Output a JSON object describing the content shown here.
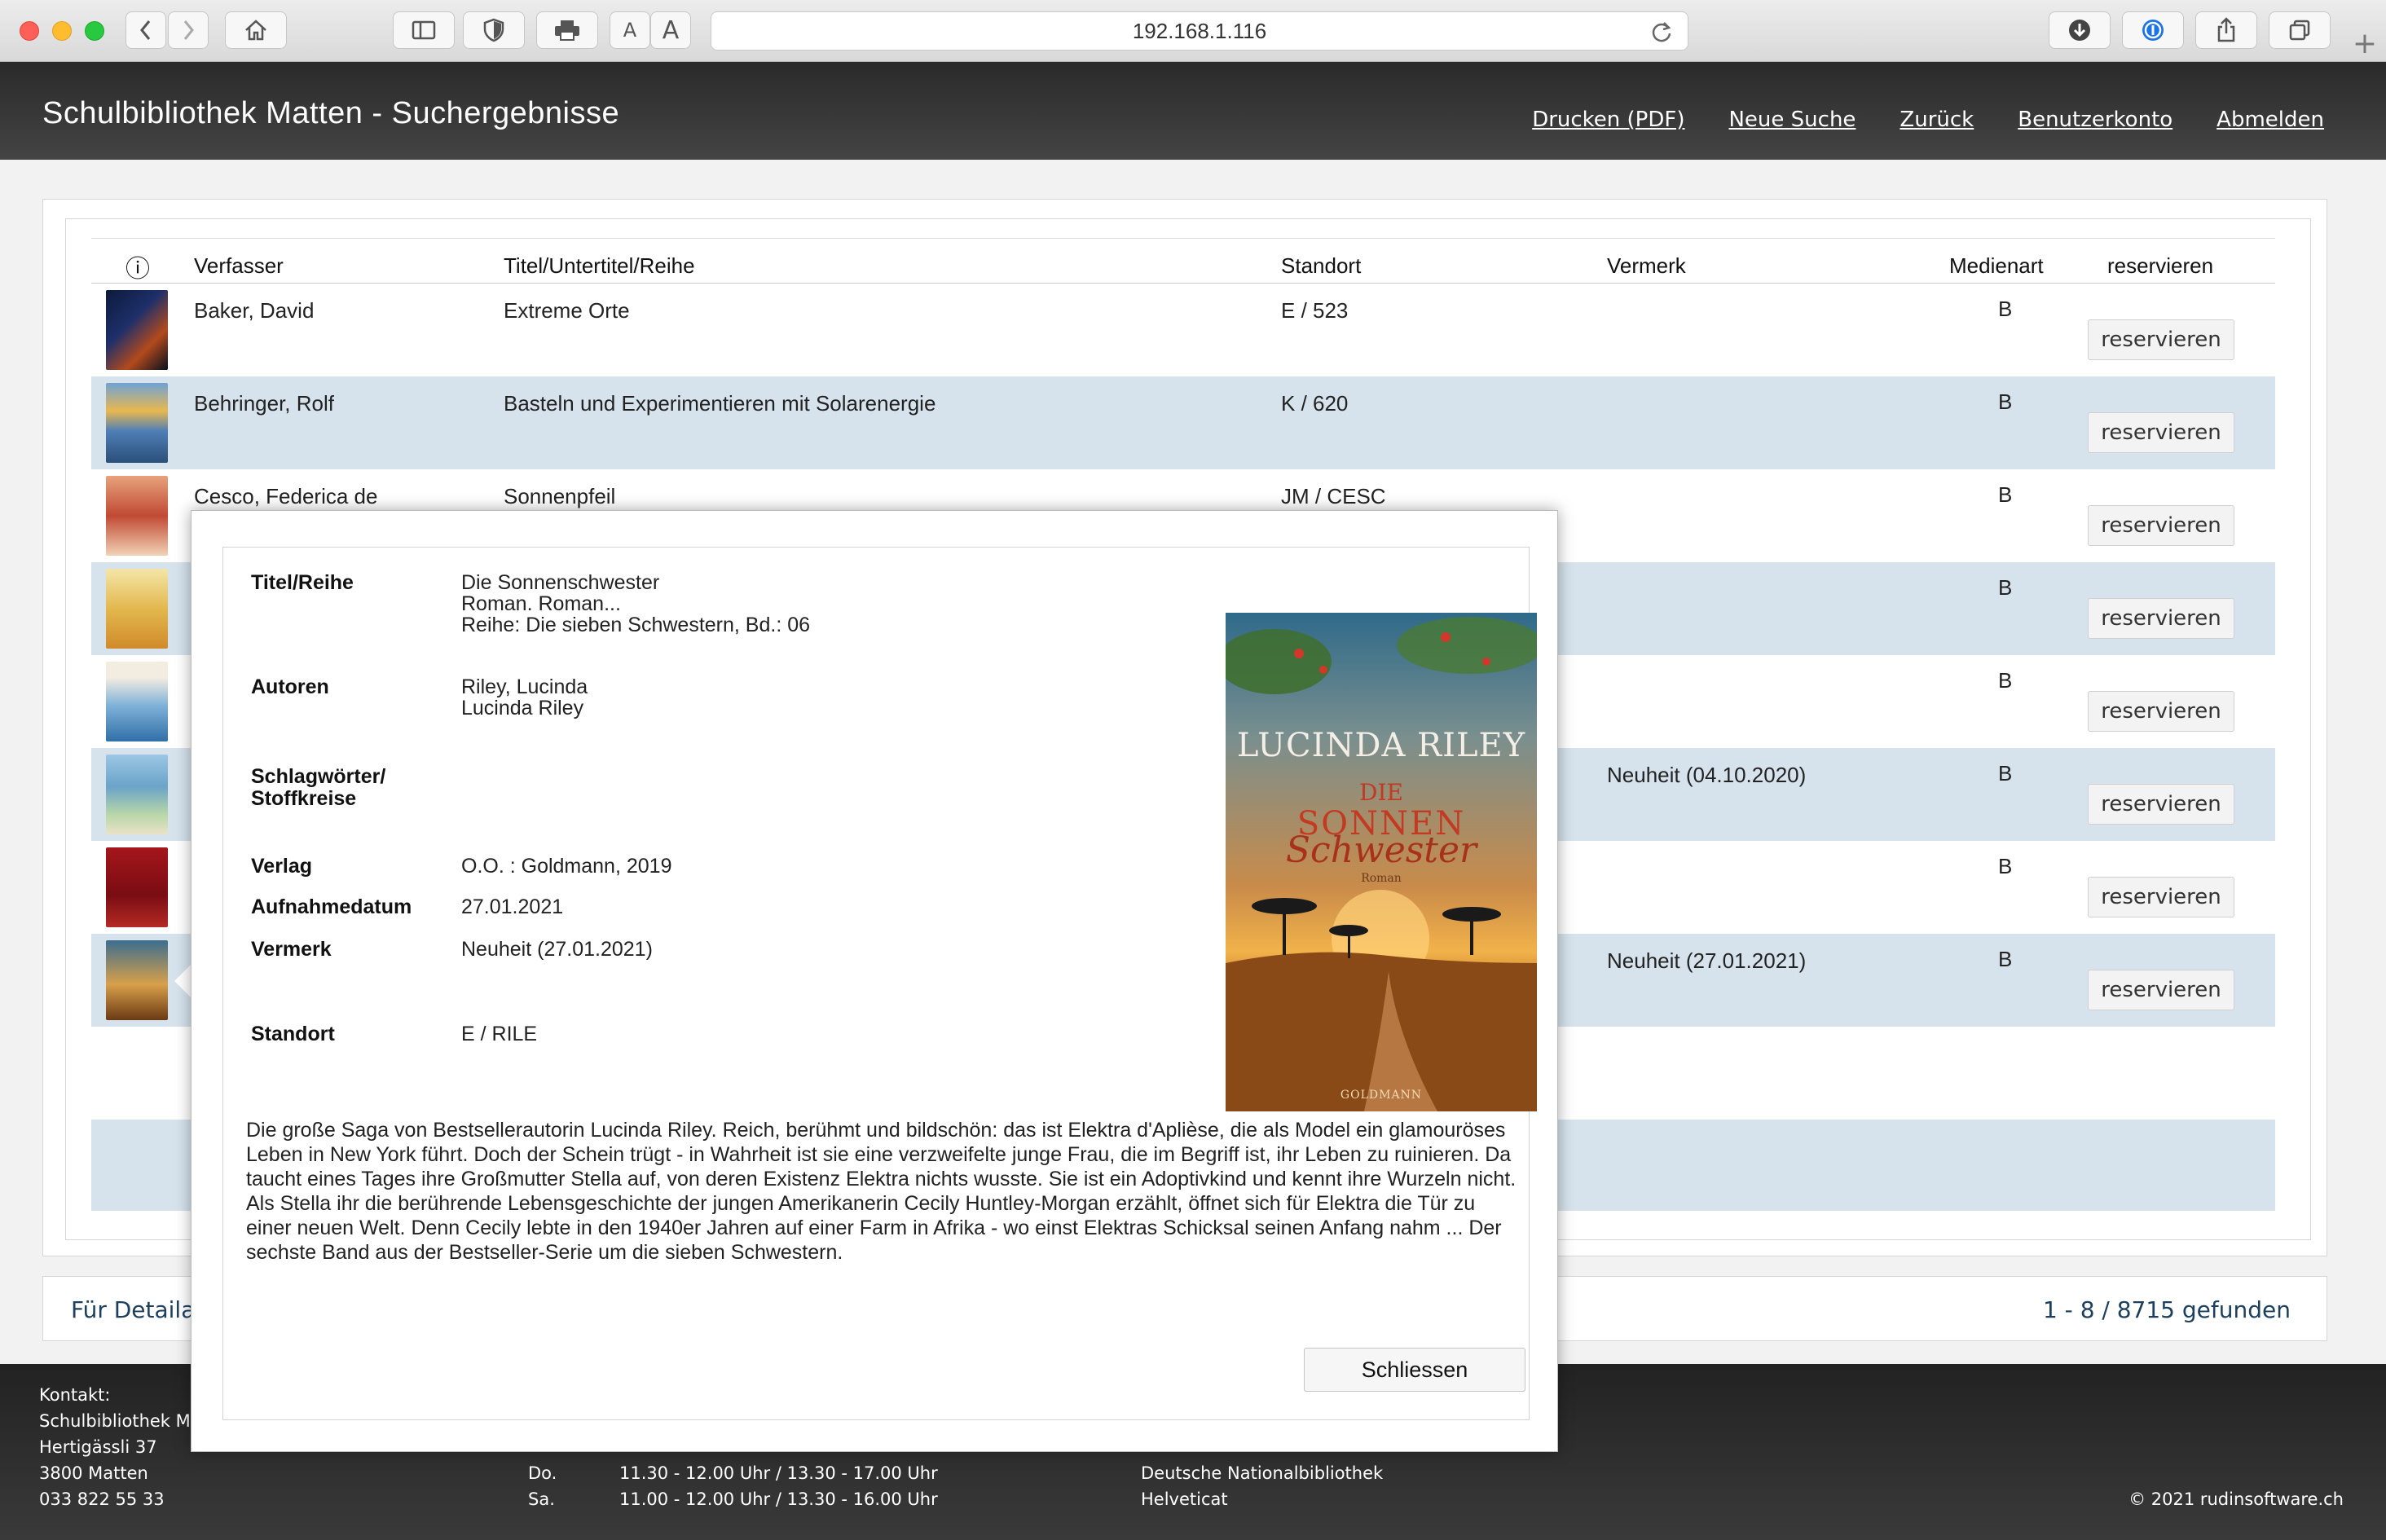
{
  "browser": {
    "url": "192.168.1.116",
    "text_small_label": "A",
    "text_large_label": "A",
    "new_tab_label": "+"
  },
  "header": {
    "title": "Schulbibliothek Matten - Suchergebnisse",
    "nav": [
      "Drucken (PDF)",
      "Neue Suche",
      "Zurück",
      "Benutzerkonto",
      "Abmelden"
    ]
  },
  "table": {
    "columns": {
      "info": "ⓘ",
      "author": "Verfasser",
      "title": "Titel/Untertitel/Reihe",
      "location": "Standort",
      "note": "Vermerk",
      "media": "Medienart",
      "reserve": "reservieren"
    },
    "rows": [
      {
        "author": "Baker, David",
        "title": "Extreme Orte",
        "location": "E / 523",
        "note": "",
        "media": "B",
        "button": "reservieren"
      },
      {
        "author": "Behringer, Rolf",
        "title": "Basteln und Experimentieren mit Solarenergie",
        "location": "K / 620",
        "note": "",
        "media": "B",
        "button": "reservieren"
      },
      {
        "author": "Cesco, Federica de",
        "title": "Sonnenpfeil",
        "location": "JM / CESC",
        "note": "",
        "media": "B",
        "button": "reservieren"
      },
      {
        "author": "",
        "title": "",
        "location": "",
        "note": "",
        "media": "B",
        "button": "reservieren"
      },
      {
        "author": "",
        "title": "",
        "location": "",
        "note": "",
        "media": "B",
        "button": "reservieren"
      },
      {
        "author": "",
        "title": "",
        "location": "",
        "note": "Neuheit (04.10.2020)",
        "media": "B",
        "button": "reservieren"
      },
      {
        "author": "",
        "title": "",
        "location": "",
        "note": "",
        "media": "B",
        "button": "reservieren"
      },
      {
        "author": "",
        "title": "",
        "location": "",
        "note": "Neuheit (27.01.2021)",
        "media": "B",
        "button": "reservieren"
      }
    ]
  },
  "status": {
    "left": "Für Detailan",
    "right": "1 - 8 / 8715 gefunden"
  },
  "footer": {
    "contact_label": "Kontakt:",
    "contact_name": "Schulbibliothek Ma",
    "street": "Hertigässli 37",
    "city": "3800 Matten",
    "phone": "033 822 55 33",
    "hours": [
      {
        "day": "Do.",
        "time": "11.30 - 12.00 Uhr / 13.30 - 17.00 Uhr"
      },
      {
        "day": "Sa.",
        "time": "11.00 - 12.00 Uhr / 13.30 - 16.00 Uhr"
      }
    ],
    "links": [
      "Deutsche Nationalbibliothek",
      "Helveticat"
    ],
    "copyright": "© 2021 rudinsoftware.ch"
  },
  "modal": {
    "labels": {
      "title": "Titel/Reihe",
      "authors": "Autoren",
      "keywords_1": "Schlagwörter/",
      "keywords_2": "Stoffkreise",
      "publisher": "Verlag",
      "date": "Aufnahmedatum",
      "note": "Vermerk",
      "location": "Standort"
    },
    "values": {
      "title_lines": [
        "Die Sonnenschwester",
        "Roman. Roman...",
        "Reihe: Die sieben Schwestern, Bd.: 06"
      ],
      "author_lines": [
        "Riley, Lucinda",
        "Lucinda Riley"
      ],
      "publisher": "O.O. : Goldmann, 2019",
      "date": "27.01.2021",
      "note": "Neuheit (27.01.2021)",
      "location": "E / RILE"
    },
    "cover": {
      "author": "LUCINDA RILEY",
      "title_1": "DIE",
      "title_2": "SONNEN",
      "title_3": "Schwester",
      "genre": "Roman",
      "publisher": "GOLDMANN"
    },
    "description": "Die große Saga von Bestsellerautorin Lucinda Riley. Reich, berühmt und bildschön: das ist Elektra d'Aplièse, die als Model ein glamouröses Leben in New York führt. Doch der Schein trügt - in Wahrheit ist sie eine verzweifelte junge Frau, die im Begriff ist, ihr Leben zu ruinieren. Da taucht eines Tages ihre Großmutter Stella auf, von deren Existenz Elektra nichts wusste. Sie ist ein Adoptivkind und kennt ihre Wurzeln nicht. Als Stella ihr die berührende Lebensgeschichte der jungen Amerikanerin Cecily Huntley-Morgan erzählt, öffnet sich für Elektra die Tür zu einer neuen Welt. Denn Cecily lebte in den 1940er Jahren auf einer Farm in Afrika - wo einst Elektras Schicksal seinen Anfang nahm ... Der sechste Band aus der Bestseller-Serie um die sieben Schwestern.",
    "close_label": "Schliessen"
  }
}
